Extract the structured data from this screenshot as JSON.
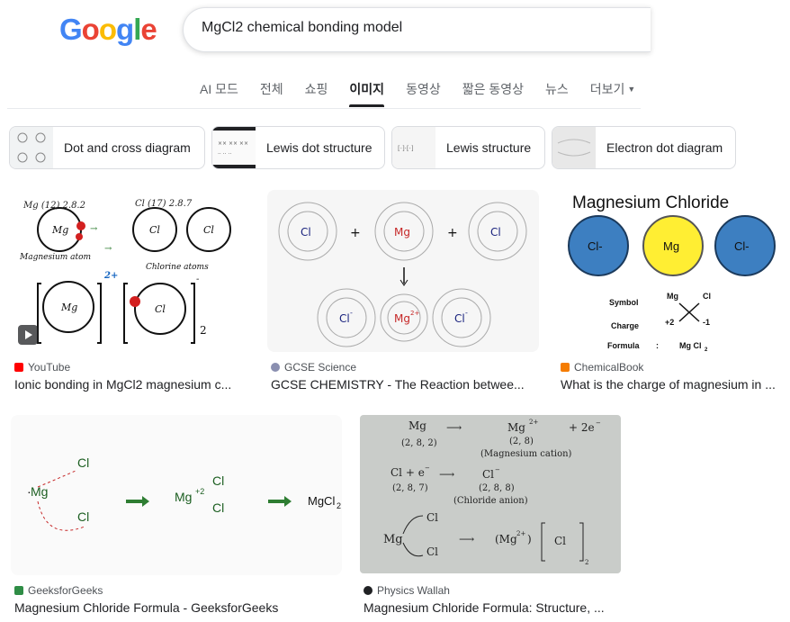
{
  "logo": [
    "G",
    "o",
    "o",
    "g",
    "l",
    "e"
  ],
  "search": {
    "query": "MgCl2 chemical bonding model"
  },
  "tabs": [
    {
      "label": "AI 모드"
    },
    {
      "label": "전체"
    },
    {
      "label": "쇼핑"
    },
    {
      "label": "이미지"
    },
    {
      "label": "동영상"
    },
    {
      "label": "짧은 동영상"
    },
    {
      "label": "뉴스"
    },
    {
      "label": "더보기"
    }
  ],
  "chips": [
    {
      "label": "Dot and cross diagram"
    },
    {
      "label": "Lewis dot structure"
    },
    {
      "label": "Lewis structure"
    },
    {
      "label": "Electron dot diagram"
    }
  ],
  "results": [
    {
      "source": "YouTube",
      "title": "Ionic bonding in MgCl2 magnesium c...",
      "favicon_color": "#ff0000",
      "img_text": {
        "mg_config": "Mg (12) 2.8.2",
        "cl_config": "Cl (17) 2.8.7",
        "mg_atom": "Magnesium atom",
        "cl_atoms": "Chlorine atoms",
        "mg": "Mg",
        "cl": "Cl",
        "charge_pos": "2+",
        "charge_neg": "-",
        "subscript": "2"
      }
    },
    {
      "source": "GCSE Science",
      "title": "GCSE CHEMISTRY - The Reaction betwee...",
      "favicon_color": "#5f6368",
      "img_text": {
        "cl": "Cl",
        "mg": "Mg",
        "plus": "+",
        "cl_ion": "Cl",
        "cl_charge": "-",
        "mg_ion": "Mg",
        "mg_charge": "2+"
      }
    },
    {
      "source": "ChemicalBook",
      "title": "What is the charge of magnesium in ...",
      "favicon_color": "#f57c00",
      "img_text": {
        "heading": "Magnesium Chloride",
        "cl": "Cl-",
        "mg": "Mg",
        "symbol": "Symbol",
        "charge": "Charge",
        "formula": "Formula",
        "colon": ":",
        "sym_mg": "Mg",
        "sym_cl": "Cl",
        "mg_charge": "+2",
        "cl_charge": "-1",
        "formula_val": "Mg Cl",
        "formula_sub": "2"
      }
    },
    {
      "source": "GeeksforGeeks",
      "title": "Magnesium Chloride Formula - GeeksforGeeks",
      "favicon_color": "#2f8d46",
      "img_text": {
        "mg": "Mg",
        "cl": "Cl",
        "mg_ion": "Mg",
        "mg_charge": "+2",
        "product": "MgCl",
        "product_sub": "2"
      }
    },
    {
      "source": "Physics Wallah",
      "title": "Magnesium Chloride Formula: Structure, ...",
      "favicon_color": "#202124",
      "img_text": {
        "l1a": "Mg",
        "l1b": "(2, 8, 2)",
        "l1c": "Mg",
        "l1c_sup": "2+",
        "l1d": "+ 2e",
        "l1d_sup": "−",
        "l1e": "(2, 8)",
        "l1f": "(Magnesium cation)",
        "l2a": "Cl + e",
        "l2a_sup": "−",
        "l2b": "(2, 8, 7)",
        "l2c": "Cl",
        "l2c_sup": "−",
        "l2d": "(2, 8, 8)",
        "l2e": "(Chloride anion)",
        "l3a": "Mg",
        "l3b": "Cl",
        "l3c": "(Mg",
        "l3c_sup": "2+",
        "l3d": ")",
        "l3e": "Cl",
        "l3f": "2"
      }
    }
  ]
}
